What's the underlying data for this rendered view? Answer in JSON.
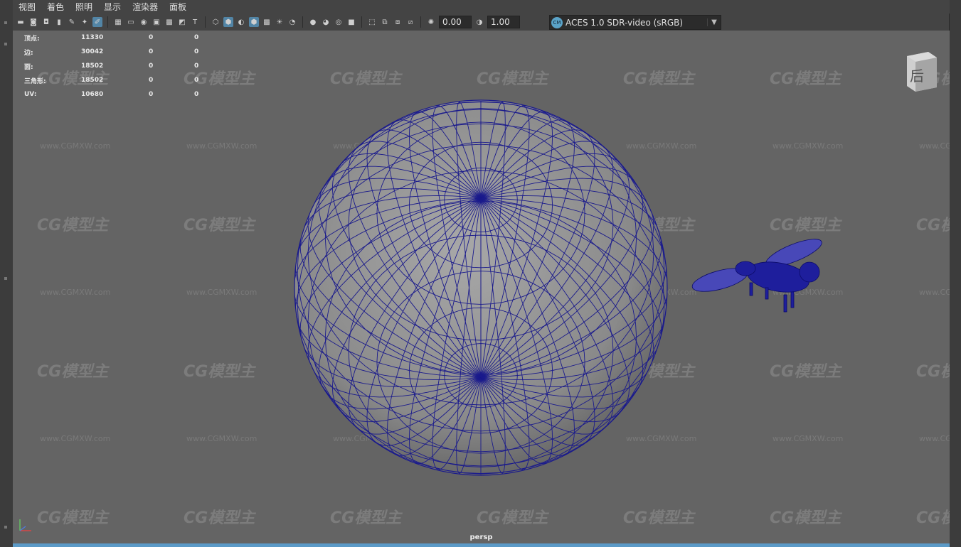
{
  "menu": [
    "视图",
    "着色",
    "照明",
    "显示",
    "渲染器",
    "面板"
  ],
  "toolbar": {
    "exposure_value": "0.00",
    "gamma_value": "1.00",
    "color_space": "ACES 1.0 SDR-video (sRGB)"
  },
  "hud": {
    "rows": [
      {
        "label": "顶点:",
        "value": "11330",
        "a": "0",
        "b": "0"
      },
      {
        "label": "边:",
        "value": "30042",
        "a": "0",
        "b": "0"
      },
      {
        "label": "面:",
        "value": "18502",
        "a": "0",
        "b": "0"
      },
      {
        "label": "三角形:",
        "value": "18502",
        "a": "0",
        "b": "0"
      },
      {
        "label": "UV:",
        "value": "10680",
        "a": "0",
        "b": "0"
      }
    ]
  },
  "viewcube": {
    "face_label": "后"
  },
  "camera_label": "persp",
  "watermark": {
    "logo": "CG模型主",
    "url": "www.CGMXW.com"
  },
  "colors": {
    "viewport_bg": "#646464",
    "wireframe": "#1a1a8c",
    "active_accent": "#5285a6",
    "bottom_bar": "#5b9ac7"
  }
}
